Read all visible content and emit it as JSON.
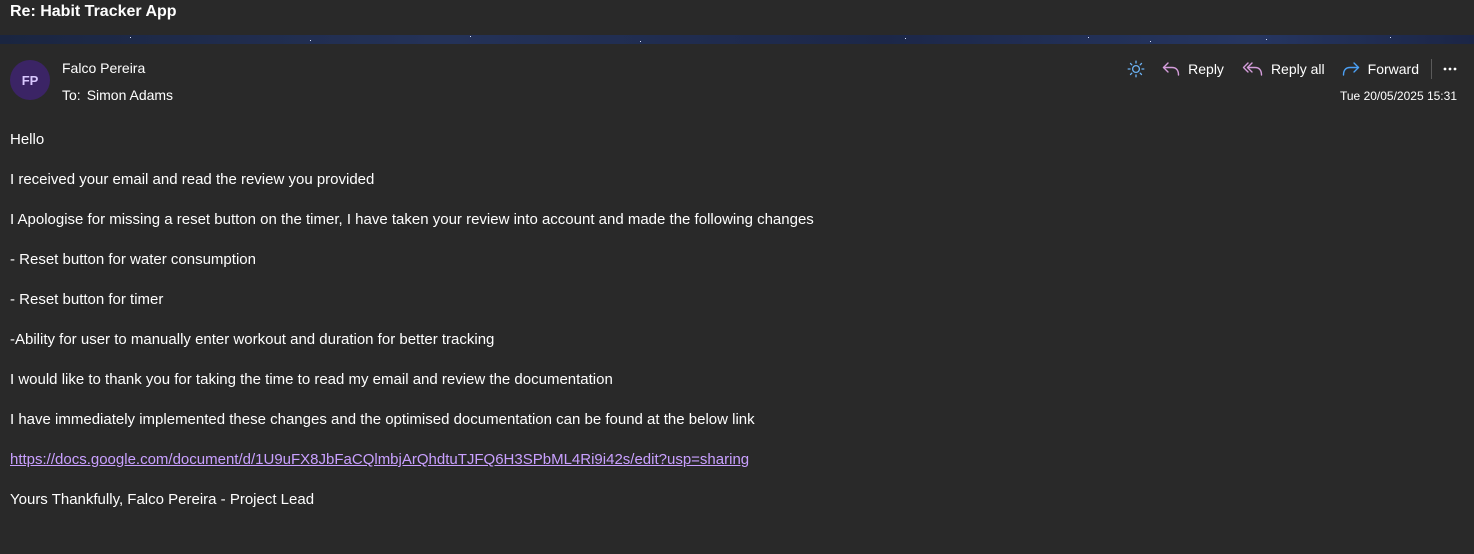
{
  "email": {
    "subject": "Re: Habit Tracker App",
    "sender": {
      "name": "Falco Pereira",
      "initials": "FP"
    },
    "to_label": "To:",
    "recipient": "Simon Adams",
    "date": "Tue 20/05/2025 15:31",
    "body": {
      "greeting": "Hello",
      "line1": "I received your email and read the review you provided",
      "line2": "I Apologise for missing a reset button on the timer, I have taken your review into account and made the following changes",
      "change1": "- Reset button for water consumption",
      "change2": "- Reset button for timer",
      "change3": "-Ability for user to manually enter workout and duration for better tracking",
      "line3": "I would like to thank you for taking the time to read my email and review the documentation",
      "line4": "I have immediately implemented these changes and the optimised documentation can be found at the below link",
      "link": "https://docs.google.com/document/d/1U9uFX8JbFaCQlmbjArQhdtuTJFQ6H3SPbML4Ri9i42s/edit?usp=sharing",
      "signoff": "Yours Thankfully, Falco Pereira - Project Lead"
    }
  },
  "toolbar": {
    "summarize_icon": "sun-icon",
    "reply_label": "Reply",
    "reply_all_label": "Reply all",
    "forward_label": "Forward",
    "more_icon": "more-icon"
  },
  "colors": {
    "background": "#292929",
    "link": "#c9a0ff",
    "reply_icon": "#d59ddb",
    "forward_icon": "#4ba0f5",
    "sun_icon": "#6cb3f5",
    "avatar_bg": "#3b2465"
  }
}
